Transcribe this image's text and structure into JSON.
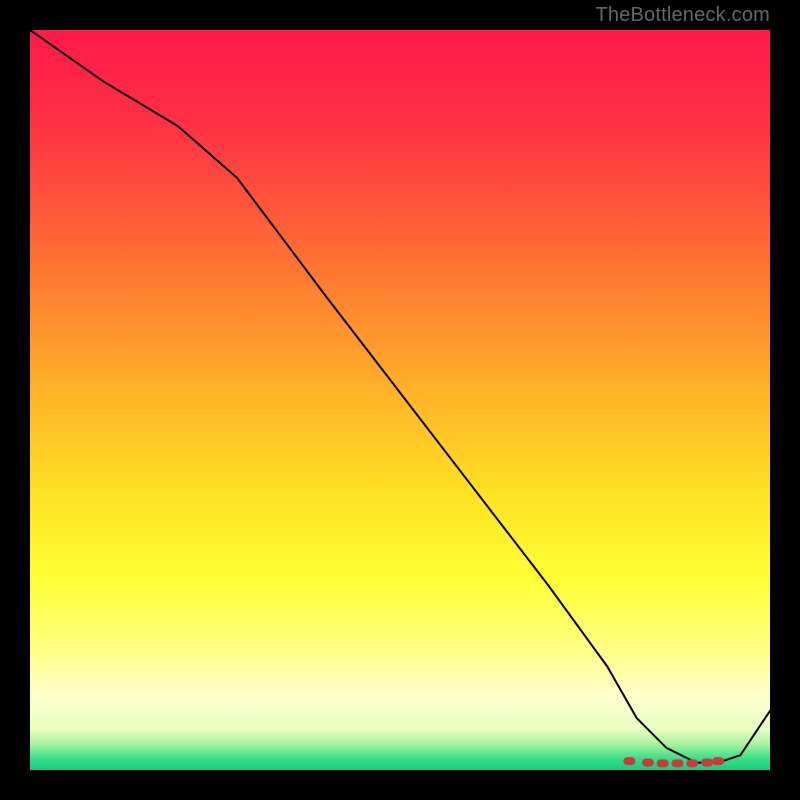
{
  "watermark": "TheBottleneck.com",
  "chart_data": {
    "type": "line",
    "title": "",
    "xlabel": "",
    "ylabel": "",
    "xlim": [
      0,
      100
    ],
    "ylim": [
      0,
      100
    ],
    "grid": false,
    "legend": false,
    "background_gradient": {
      "stops": [
        {
          "pos": 0.0,
          "color": "#ff1a4a"
        },
        {
          "pos": 0.12,
          "color": "#ff2f44"
        },
        {
          "pos": 0.25,
          "color": "#ff5a38"
        },
        {
          "pos": 0.38,
          "color": "#ff8a2f"
        },
        {
          "pos": 0.5,
          "color": "#ffb628"
        },
        {
          "pos": 0.62,
          "color": "#ffdf22"
        },
        {
          "pos": 0.74,
          "color": "#ffff33"
        },
        {
          "pos": 0.84,
          "color": "#ffff88"
        },
        {
          "pos": 0.9,
          "color": "#ffffcc"
        },
        {
          "pos": 0.945,
          "color": "#e8ffc0"
        },
        {
          "pos": 0.965,
          "color": "#a8f2a0"
        },
        {
          "pos": 0.985,
          "color": "#38dd88"
        },
        {
          "pos": 1.0,
          "color": "#18cc80"
        }
      ]
    },
    "series": [
      {
        "name": "curve",
        "color": "#000000",
        "width": 2,
        "x": [
          0,
          10,
          20,
          28,
          40,
          50,
          60,
          70,
          78,
          82,
          86,
          90,
          93,
          96,
          100
        ],
        "y": [
          100,
          93,
          87,
          80,
          64,
          51,
          38,
          25,
          14,
          7,
          3,
          1,
          1,
          2,
          8
        ]
      }
    ],
    "markers": {
      "name": "bottom-cluster",
      "color": "#cc3b3b",
      "shape": "rounded-rect",
      "x": [
        81,
        83.5,
        85.5,
        87.5,
        89.5,
        91.5,
        93
      ],
      "y": [
        1.2,
        1.0,
        0.9,
        0.9,
        0.9,
        1.0,
        1.2
      ]
    }
  }
}
